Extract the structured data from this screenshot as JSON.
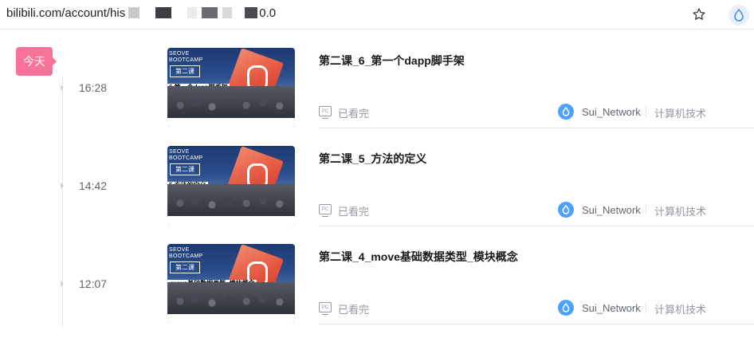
{
  "browser": {
    "url_visible": "bilibili.com/account/his",
    "url_tail": "0.0",
    "redaction_colors": [
      "#c8c9cb",
      "#3d3e42",
      "#e9eaec",
      "#6b6c70",
      "#d9dadc",
      "#4a4b50"
    ],
    "bookmark_icon": "star-icon",
    "extension_icon": "droplet-icon"
  },
  "timeline": {
    "day_label": "今天",
    "accent": "#fb7299"
  },
  "entries": [
    {
      "time": "16:28",
      "title": "第二课_6_第一个dapp脚手架",
      "thumb": {
        "brand_line1": "SEOVE",
        "brand_line2": "BOOTCAMP",
        "lesson": "第二课",
        "caption": "6.第一个dapp脚手架"
      },
      "device": "PC",
      "status": "已看完",
      "up_name": "Sui_Network",
      "category": "计算机技术"
    },
    {
      "time": "14:42",
      "title": "第二课_5_方法的定义",
      "thumb": {
        "brand_line1": "SEOVE",
        "brand_line2": "BOOTCAMP",
        "lesson": "第二课",
        "caption": "5.方法的定义"
      },
      "device": "PC",
      "status": "已看完",
      "up_name": "Sui_Network",
      "category": "计算机技术"
    },
    {
      "time": "12:07",
      "title": "第二课_4_move基础数据类型_模块概念",
      "thumb": {
        "brand_line1": "SEOVE",
        "brand_line2": "BOOTCAMP",
        "lesson": "第二课",
        "caption": ".move基础数据类型_模块概念"
      },
      "device": "PC",
      "status": "已看完",
      "up_name": "Sui_Network",
      "category": "计算机技术"
    }
  ]
}
